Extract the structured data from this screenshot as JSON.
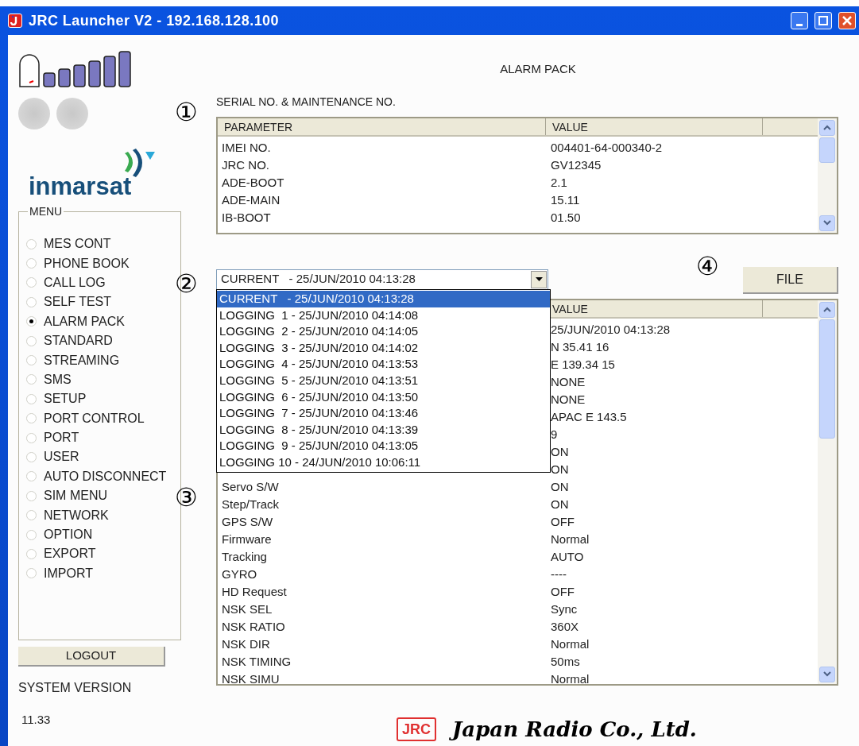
{
  "window": {
    "title": "JRC Launcher V2 - 192.168.128.100"
  },
  "sidebar": {
    "logo_text": "inmarsat",
    "menu": {
      "legend": "MENU",
      "items": [
        {
          "label": "MES CONT",
          "selected": false
        },
        {
          "label": "PHONE BOOK",
          "selected": false
        },
        {
          "label": "CALL LOG",
          "selected": false
        },
        {
          "label": "SELF TEST",
          "selected": false
        },
        {
          "label": "ALARM PACK",
          "selected": true
        },
        {
          "label": "STANDARD",
          "selected": false
        },
        {
          "label": "STREAMING",
          "selected": false
        },
        {
          "label": "SMS",
          "selected": false
        },
        {
          "label": "SETUP",
          "selected": false
        },
        {
          "label": "PORT CONTROL",
          "selected": false
        },
        {
          "label": "PORT",
          "selected": false
        },
        {
          "label": "USER",
          "selected": false
        },
        {
          "label": "AUTO DISCONNECT",
          "selected": false
        },
        {
          "label": "SIM MENU",
          "selected": false
        },
        {
          "label": "NETWORK",
          "selected": false
        },
        {
          "label": "OPTION",
          "selected": false
        },
        {
          "label": "EXPORT",
          "selected": false
        },
        {
          "label": "IMPORT",
          "selected": false
        }
      ]
    },
    "logout_button": "LOGOUT",
    "system_version_label": "SYSTEM VERSION",
    "system_version": "11.33"
  },
  "main": {
    "title": "ALARM PACK",
    "serial_section": {
      "marker": "①",
      "caption": "SERIAL NO. & MAINTENANCE NO.",
      "columns": [
        "PARAMETER",
        "VALUE"
      ],
      "rows": [
        {
          "parameter": "IMEI NO.",
          "value": "004401-64-000340-2"
        },
        {
          "parameter": "JRC NO.",
          "value": "GV12345"
        },
        {
          "parameter": "ADE-BOOT",
          "value": "2.1"
        },
        {
          "parameter": "ADE-MAIN",
          "value": "15.11"
        },
        {
          "parameter": "IB-BOOT",
          "value": "01.50"
        }
      ]
    },
    "log_select": {
      "marker": "②",
      "value": "CURRENT   - 25/JUN/2010 04:13:28",
      "expanded": true,
      "options": [
        {
          "label": "CURRENT   - 25/JUN/2010 04:13:28",
          "selected": true
        },
        {
          "label": "LOGGING  1 - 25/JUN/2010 04:14:08",
          "selected": false
        },
        {
          "label": "LOGGING  2 - 25/JUN/2010 04:14:05",
          "selected": false
        },
        {
          "label": "LOGGING  3 - 25/JUN/2010 04:14:02",
          "selected": false
        },
        {
          "label": "LOGGING  4 - 25/JUN/2010 04:13:53",
          "selected": false
        },
        {
          "label": "LOGGING  5 - 25/JUN/2010 04:13:51",
          "selected": false
        },
        {
          "label": "LOGGING  6 - 25/JUN/2010 04:13:50",
          "selected": false
        },
        {
          "label": "LOGGING  7 - 25/JUN/2010 04:13:46",
          "selected": false
        },
        {
          "label": "LOGGING  8 - 25/JUN/2010 04:13:39",
          "selected": false
        },
        {
          "label": "LOGGING  9 - 25/JUN/2010 04:13:05",
          "selected": false
        },
        {
          "label": "LOGGING 10 - 24/JUN/2010 10:06:11",
          "selected": false
        }
      ]
    },
    "file_button": {
      "marker": "④",
      "label": "FILE"
    },
    "log_section": {
      "marker": "③",
      "columns": [
        "VALUE"
      ],
      "rows": [
        {
          "value": "25/JUN/2010 04:13:28"
        },
        {
          "value": "N 35.41 16"
        },
        {
          "value": "E 139.34 15"
        },
        {
          "value": "NONE"
        },
        {
          "value": "NONE"
        },
        {
          "value": "APAC E 143.5"
        },
        {
          "value": "9"
        },
        {
          "value": "ON"
        },
        {
          "value": "ON"
        },
        {
          "parameter": "Servo S/W",
          "value": "ON"
        },
        {
          "parameter": "Step/Track",
          "value": "ON"
        },
        {
          "parameter": "GPS S/W",
          "value": "OFF"
        },
        {
          "parameter": "Firmware",
          "value": "Normal"
        },
        {
          "parameter": "Tracking",
          "value": "AUTO"
        },
        {
          "parameter": "GYRO",
          "value": "----"
        },
        {
          "parameter": "HD Request",
          "value": "OFF"
        },
        {
          "parameter": "NSK SEL",
          "value": "Sync"
        },
        {
          "parameter": "NSK RATIO",
          "value": "360X"
        },
        {
          "parameter": "NSK DIR",
          "value": "Normal"
        },
        {
          "parameter": "NSK TIMING",
          "value": "50ms"
        },
        {
          "parameter": "NSK SIMU",
          "value": "Normal"
        }
      ]
    }
  },
  "footer": {
    "logo_badge": "JRC",
    "company": "Japan Radio Co., Ltd."
  }
}
